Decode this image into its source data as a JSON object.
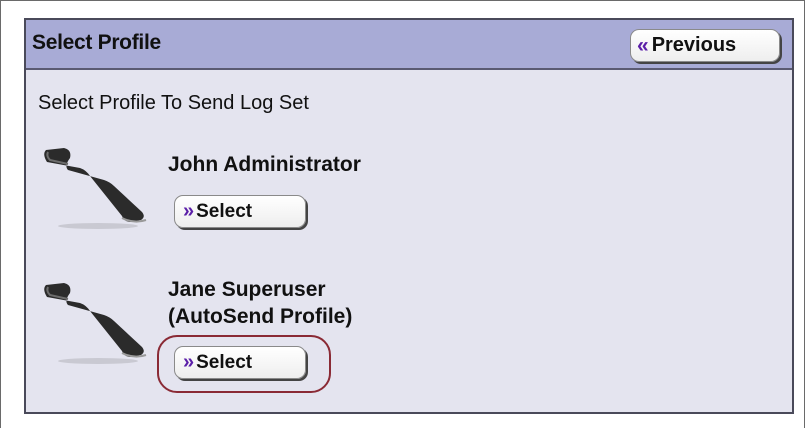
{
  "header": {
    "title": "Select Profile",
    "previous_label": "Previous",
    "previous_arrow": "«"
  },
  "subtitle": "Select Profile To Send Log Set",
  "profiles": [
    {
      "name_line1": "John Administrator",
      "name_line2": "",
      "select_label": "Select",
      "select_arrow": "»",
      "icon": "phone-handset-icon"
    },
    {
      "name_line1": "Jane Superuser",
      "name_line2": "(AutoSend Profile)",
      "select_label": "Select",
      "select_arrow": "»",
      "icon": "phone-handset-icon"
    }
  ],
  "colors": {
    "header_bg": "#a8abd6",
    "panel_bg": "#e4e4ef",
    "arrow_accent": "#5b1fa8",
    "highlight_ring": "#8a2a35"
  }
}
